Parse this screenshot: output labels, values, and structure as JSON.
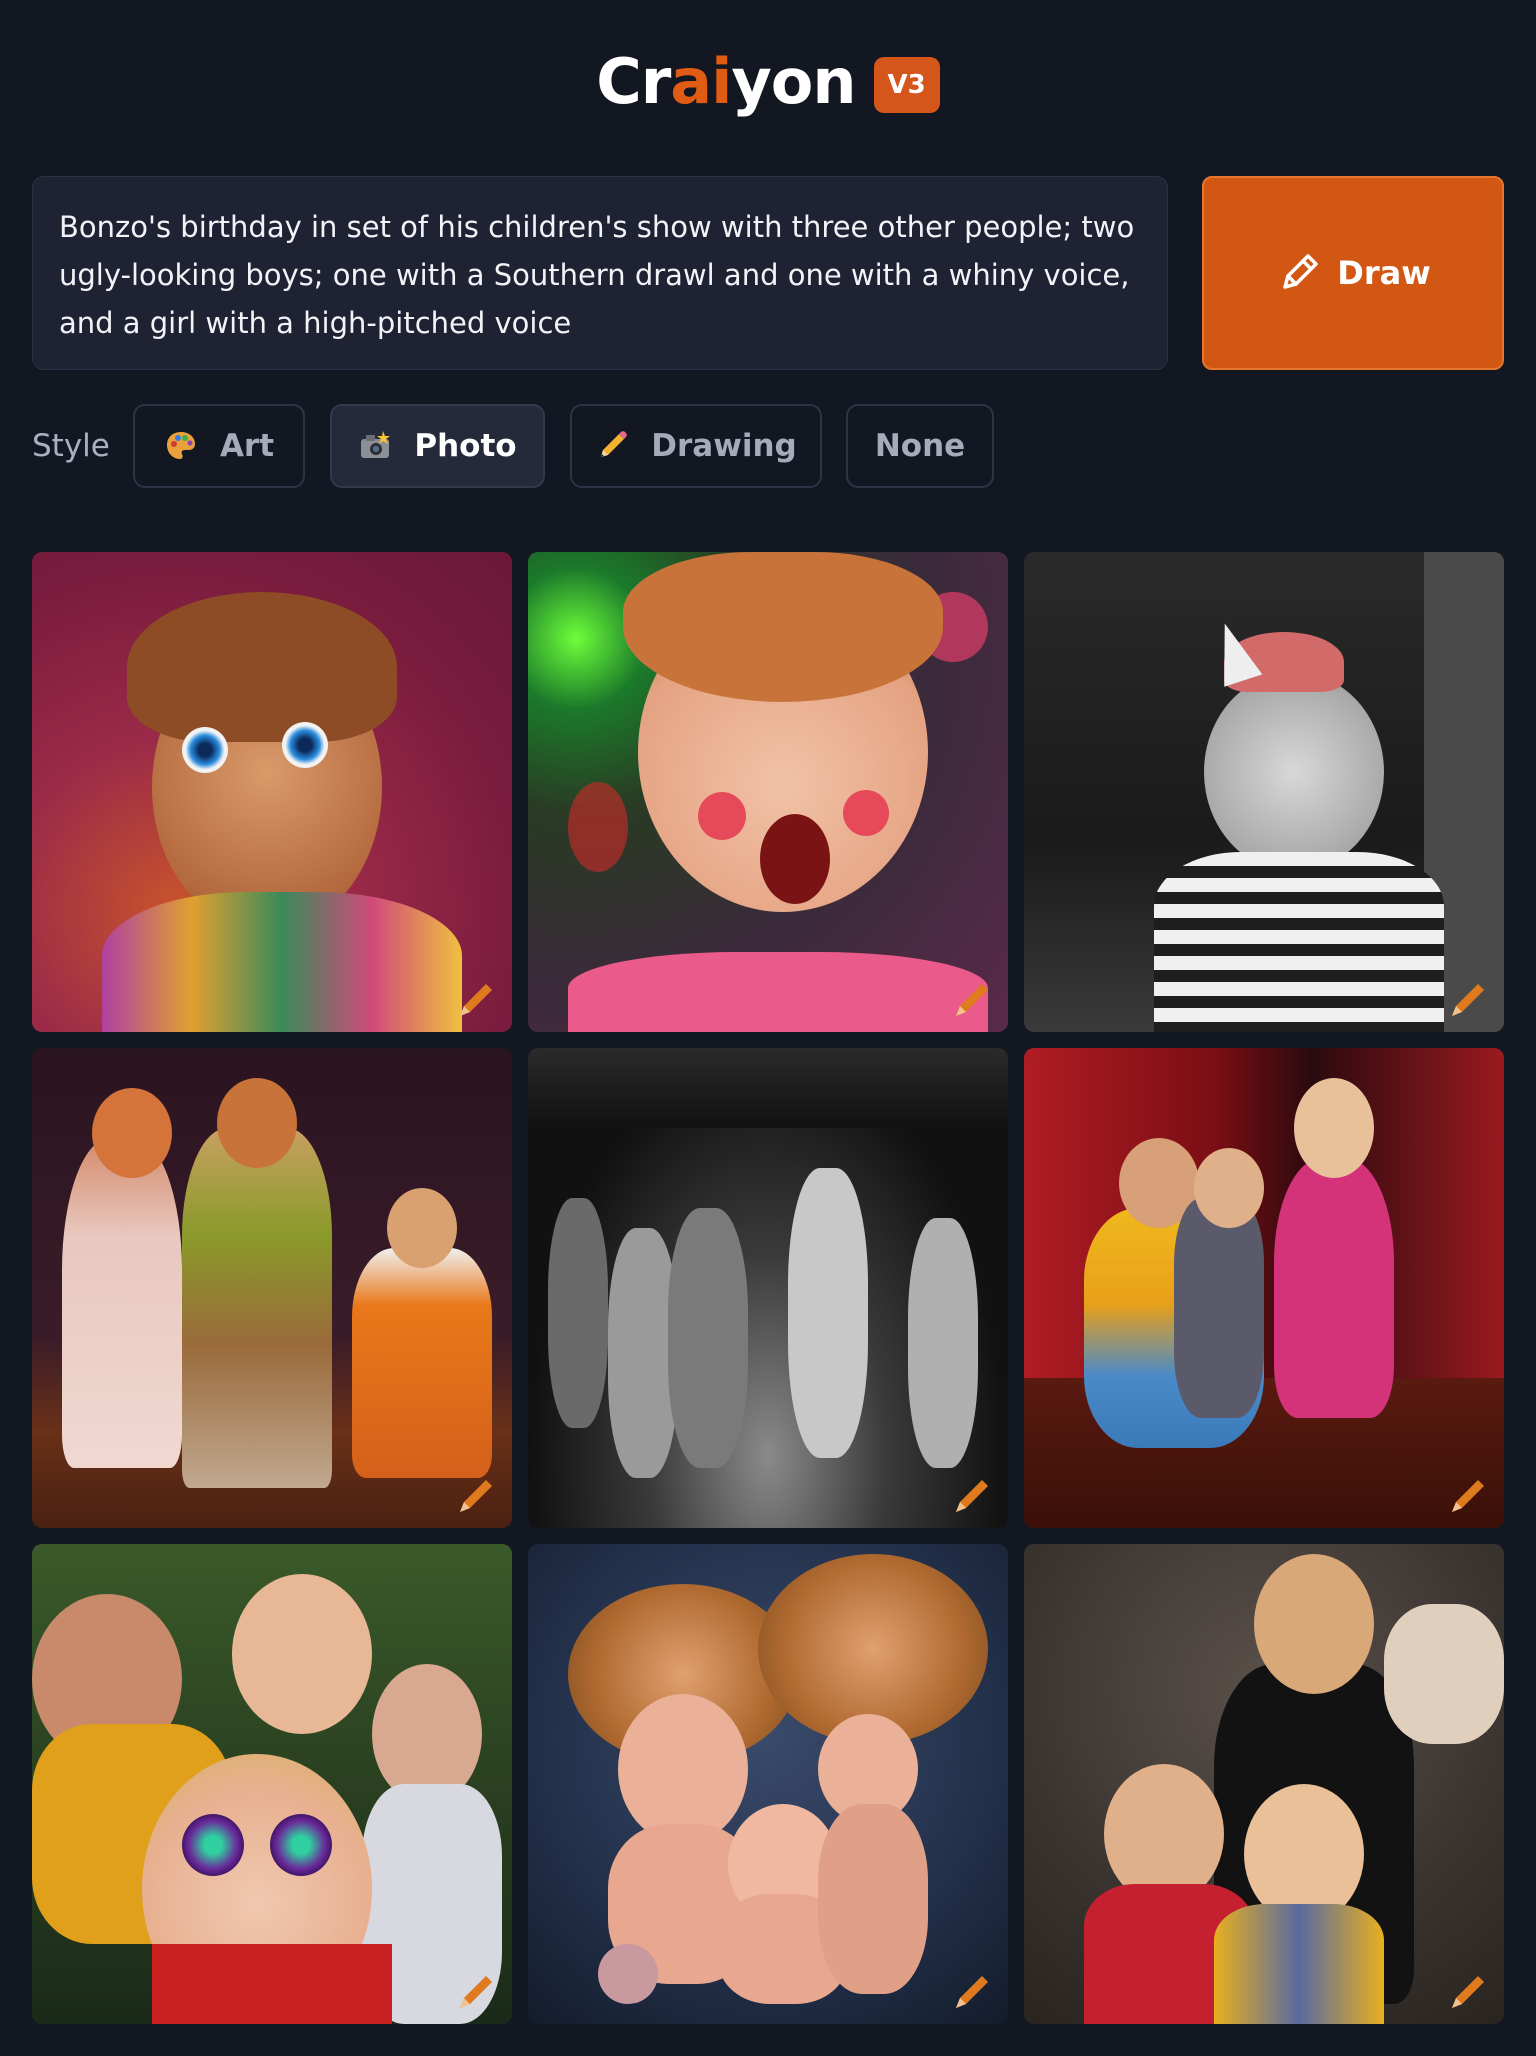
{
  "app": {
    "logo_pre": "Cr",
    "logo_mid": "ai",
    "logo_post": "yon",
    "version": "V3",
    "accent_color": "#d4561a"
  },
  "prompt": {
    "text": "Bonzo's birthday in set of his children's show with three other people; two ugly-looking boys; one with a Southern drawl and one with a whiny voice, and a girl with a high-pitched voice"
  },
  "draw_button": {
    "label": "Draw",
    "icon": "pencil-icon"
  },
  "style": {
    "label": "Style",
    "options": [
      {
        "label": "Art",
        "icon": "palette-icon",
        "selected": false
      },
      {
        "label": "Photo",
        "icon": "camera-flash-icon",
        "selected": true
      },
      {
        "label": "Drawing",
        "icon": "pencil-icon",
        "selected": false
      },
      {
        "label": "None",
        "icon": "",
        "selected": false
      }
    ]
  },
  "results": {
    "count": 9,
    "tile_icon": "edit-pencil-icon",
    "images": [
      {
        "description_icon": "generated-image"
      },
      {
        "description_icon": "generated-image"
      },
      {
        "description_icon": "generated-image"
      },
      {
        "description_icon": "generated-image"
      },
      {
        "description_icon": "generated-image"
      },
      {
        "description_icon": "generated-image"
      },
      {
        "description_icon": "generated-image"
      },
      {
        "description_icon": "generated-image"
      },
      {
        "description_icon": "generated-image"
      }
    ]
  }
}
